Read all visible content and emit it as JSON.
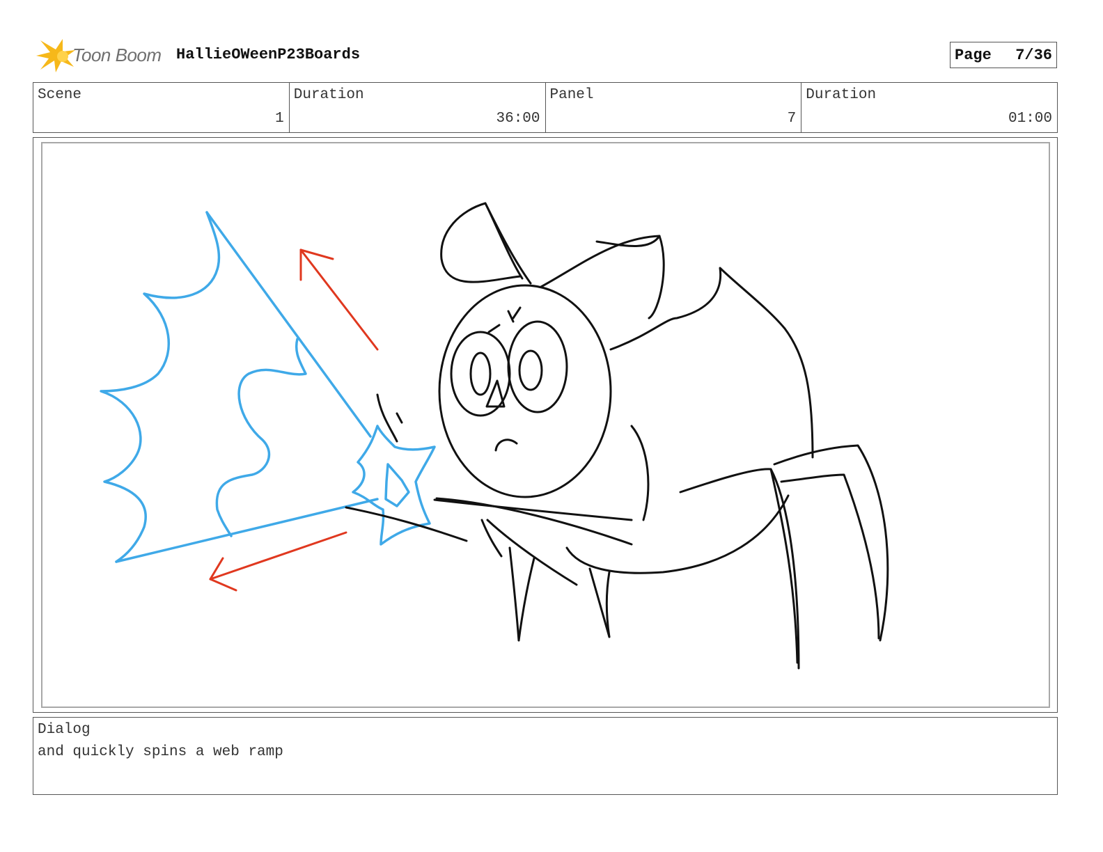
{
  "header": {
    "logo_text": "Toon Boom",
    "project_title": "HallieOWeenP23Boards",
    "page_label": "Page",
    "page_number": "7/36"
  },
  "info": {
    "scene_label": "Scene",
    "scene_value": "1",
    "scene_duration_label": "Duration",
    "scene_duration_value": "36:00",
    "panel_label": "Panel",
    "panel_value": "7",
    "panel_duration_label": "Duration",
    "panel_duration_value": "01:00"
  },
  "dialog": {
    "label": "Dialog",
    "text": "and quickly spins a web ramp"
  },
  "colors": {
    "web_lines": "#3fa9e8",
    "motion_arrows": "#e0381f",
    "ink": "#111111",
    "logo_star": "#f6b81a"
  }
}
